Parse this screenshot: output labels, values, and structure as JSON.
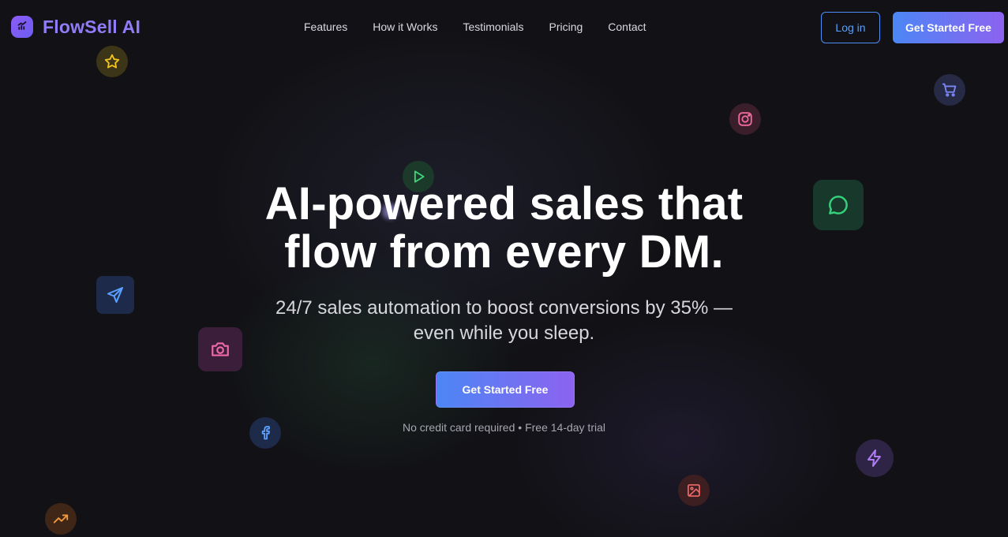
{
  "brand": {
    "name": "FlowSell AI",
    "logo_icon": "chart-chat-icon",
    "accent": "#8f7cf6"
  },
  "nav": {
    "links": [
      "Features",
      "How it Works",
      "Testimonials",
      "Pricing",
      "Contact"
    ],
    "login_label": "Log in",
    "cta_label": "Get Started Free"
  },
  "hero": {
    "title_line1": "AI-powered sales that",
    "title_line2": "flow from every DM.",
    "subtitle_line1": "24/7 sales automation to boost conversions by 35% —",
    "subtitle_line2": "even while you sleep.",
    "cta_label": "Get Started Free",
    "note": "No credit card required • Free 14-day trial"
  },
  "floating_icons": [
    "star-icon",
    "cart-icon",
    "instagram-icon",
    "play-icon",
    "chat-icon",
    "send-icon",
    "camera-icon",
    "facebook-icon",
    "bolt-icon",
    "image-icon",
    "trending-up-icon"
  ],
  "colors": {
    "background": "#121216",
    "gradient_start": "#4c86f5",
    "gradient_end": "#8c63f0",
    "login_border": "#4d8df6"
  }
}
